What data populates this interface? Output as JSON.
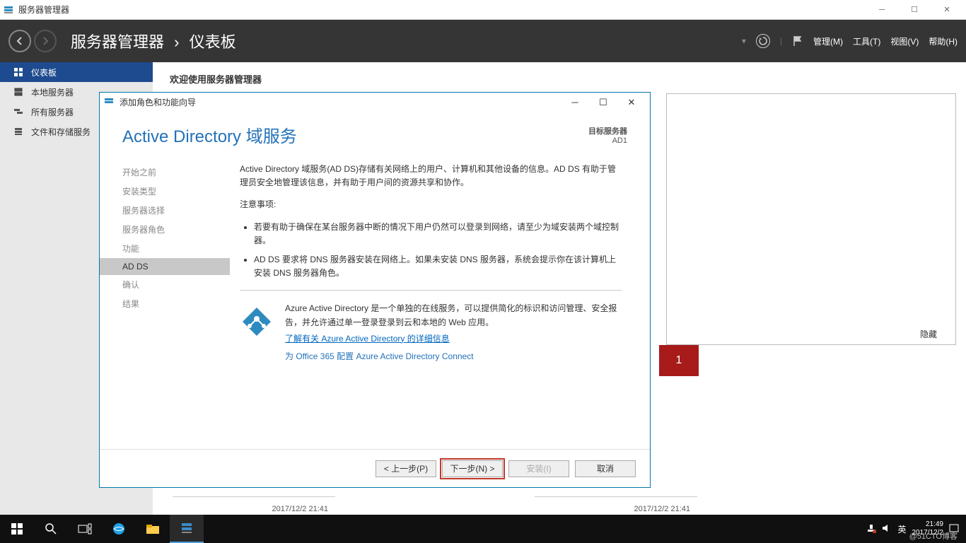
{
  "outer_window": {
    "title": "服务器管理器"
  },
  "sm_header": {
    "breadcrumb_app": "服务器管理器",
    "breadcrumb_page": "仪表板",
    "menu": {
      "manage": "管理(M)",
      "tools": "工具(T)",
      "view": "视图(V)",
      "help": "帮助(H)"
    }
  },
  "sidebar": {
    "items": [
      {
        "label": "仪表板"
      },
      {
        "label": "本地服务器"
      },
      {
        "label": "所有服务器"
      },
      {
        "label": "文件和存储服务"
      }
    ]
  },
  "content": {
    "welcome": "欢迎使用服务器管理器",
    "hide_link": "隐藏",
    "red_tile": "1",
    "timestamp1": "2017/12/2 21:41",
    "timestamp2": "2017/12/2 21:41"
  },
  "wizard": {
    "title": "添加角色和功能向导",
    "heading": "Active Directory 域服务",
    "target_label": "目标服务器",
    "target_value": "AD1",
    "steps": [
      {
        "label": "开始之前"
      },
      {
        "label": "安装类型"
      },
      {
        "label": "服务器选择"
      },
      {
        "label": "服务器角色"
      },
      {
        "label": "功能"
      },
      {
        "label": "AD DS"
      },
      {
        "label": "确认"
      },
      {
        "label": "结果"
      }
    ],
    "body": {
      "intro": "Active Directory 域服务(AD DS)存储有关网络上的用户、计算机和其他设备的信息。AD DS 有助于管理员安全地管理该信息，并有助于用户间的资源共享和协作。",
      "note_label": "注意事项:",
      "bullets": [
        "若要有助于确保在某台服务器中断的情况下用户仍然可以登录到网络，请至少为域安装两个域控制器。",
        "AD DS 要求将 DNS 服务器安装在网络上。如果未安装 DNS 服务器，系统会提示你在该计算机上安装 DNS 服务器角色。"
      ],
      "azure_desc": "Azure Active Directory 是一个单独的在线服务，可以提供简化的标识和访问管理、安全报告，并允许通过单一登录登录到云和本地的 Web 应用。",
      "azure_link": "了解有关 Azure Active Directory 的详细信息",
      "o365_link": "为 Office 365 配置 Azure Active Directory Connect"
    },
    "buttons": {
      "prev": "< 上一步(P)",
      "next": "下一步(N) >",
      "install": "安装(I)",
      "cancel": "取消"
    }
  },
  "taskbar": {
    "ime": "英",
    "time": "21:49",
    "date": "2017/12/2",
    "watermark": "@51CTO博客"
  }
}
